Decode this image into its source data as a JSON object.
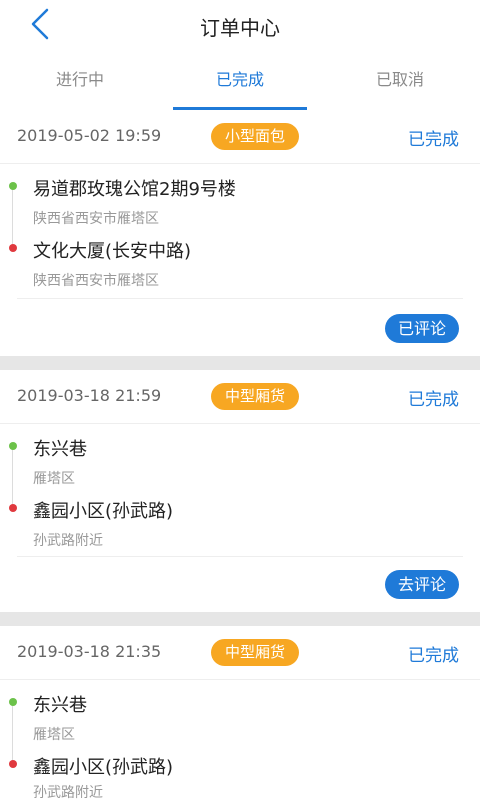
{
  "header": {
    "title": "订单中心",
    "back_icon": "chevron-left-icon"
  },
  "tabs": [
    {
      "label": "进行中",
      "active": false
    },
    {
      "label": "已完成",
      "active": true
    },
    {
      "label": "已取消",
      "active": false
    }
  ],
  "colors": {
    "accent": "#1f7ad8",
    "badge": "#f7a722",
    "start_dot": "#6cc24a",
    "end_dot": "#e0393e"
  },
  "orders": [
    {
      "time": "2019-05-02 19:59",
      "vehicle": "小型面包",
      "status": "已完成",
      "from_name": "易道郡玫瑰公馆2期9号楼",
      "from_sub": "陕西省西安市雁塔区",
      "to_name": "文化大厦(长安中路)",
      "to_sub": "陕西省西安市雁塔区",
      "action": "已评论"
    },
    {
      "time": "2019-03-18 21:59",
      "vehicle": "中型厢货",
      "status": "已完成",
      "from_name": "东兴巷",
      "from_sub": "雁塔区",
      "to_name": "鑫园小区(孙武路)",
      "to_sub": "孙武路附近",
      "action": "去评论"
    },
    {
      "time": "2019-03-18 21:35",
      "vehicle": "中型厢货",
      "status": "已完成",
      "from_name": "东兴巷",
      "from_sub": "雁塔区",
      "to_name": "鑫园小区(孙武路)",
      "to_sub": "孙武路附近"
    }
  ]
}
